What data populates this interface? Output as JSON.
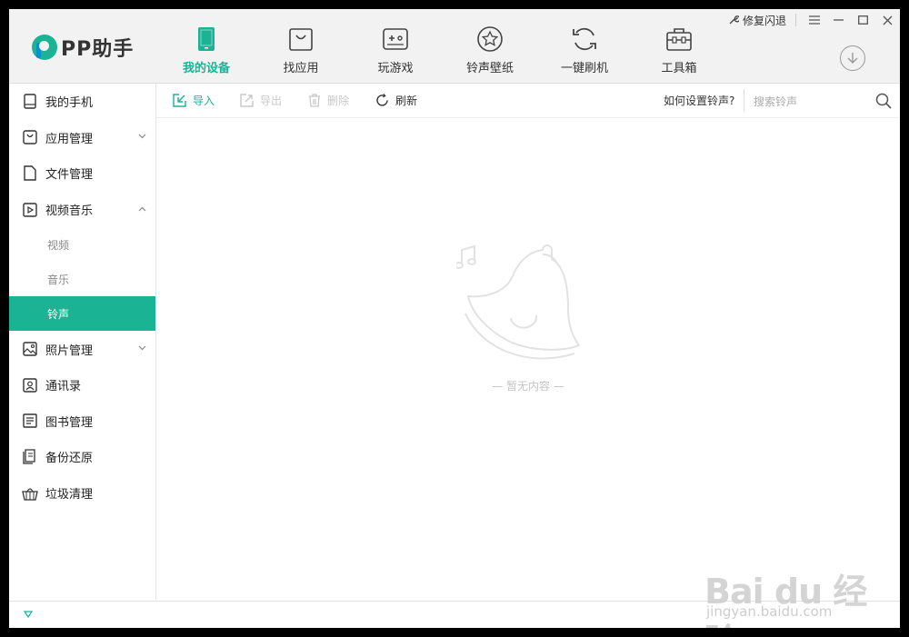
{
  "app": {
    "name": "PP助手"
  },
  "window_controls": {
    "repair_label": "修复闪退",
    "menu_icon": "menu-icon",
    "minimize_icon": "minimize-icon",
    "maximize_icon": "maximize-icon",
    "close_icon": "close-icon"
  },
  "nav": {
    "items": [
      {
        "label": "我的设备",
        "icon": "phone-icon",
        "active": true
      },
      {
        "label": "找应用",
        "icon": "app-bag-icon",
        "active": false
      },
      {
        "label": "玩游戏",
        "icon": "gamepad-icon",
        "active": false
      },
      {
        "label": "铃声壁纸",
        "icon": "star-icon",
        "active": false
      },
      {
        "label": "一键刷机",
        "icon": "refresh-icon",
        "active": false
      },
      {
        "label": "工具箱",
        "icon": "toolbox-icon",
        "active": false
      }
    ]
  },
  "sidebar": {
    "items": [
      {
        "label": "我的手机",
        "icon": "phone-outline-icon"
      },
      {
        "label": "应用管理",
        "icon": "app-icon",
        "chevron": "down"
      },
      {
        "label": "文件管理",
        "icon": "file-icon"
      },
      {
        "label": "视频音乐",
        "icon": "play-icon",
        "chevron": "up"
      },
      {
        "label": "照片管理",
        "icon": "photo-icon",
        "chevron": "down"
      },
      {
        "label": "通讯录",
        "icon": "contacts-icon"
      },
      {
        "label": "图书管理",
        "icon": "book-icon"
      },
      {
        "label": "备份还原",
        "icon": "backup-icon"
      },
      {
        "label": "垃圾清理",
        "icon": "trash-basket-icon"
      }
    ],
    "subitems": [
      {
        "label": "视频"
      },
      {
        "label": "音乐"
      },
      {
        "label": "铃声",
        "active": true
      }
    ]
  },
  "toolbar": {
    "import_label": "导入",
    "export_label": "导出",
    "delete_label": "删除",
    "refresh_label": "刷新",
    "help_label": "如何设置铃声?",
    "search_placeholder": "搜索铃声"
  },
  "content": {
    "empty_text": "— 暂无内容 —"
  },
  "watermark": {
    "text": "Bai du 经验",
    "url": "jingyan.baidu.com"
  },
  "colors": {
    "accent": "#1ab394",
    "background": "#f2f2f2"
  }
}
